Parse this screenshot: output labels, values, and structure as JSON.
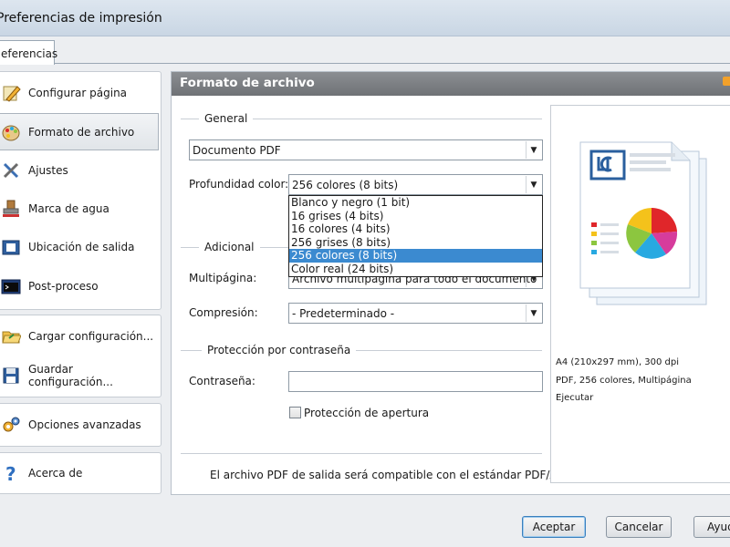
{
  "window": {
    "title": "Preferencias de impresión"
  },
  "tabs": [
    {
      "label": "eferencias"
    }
  ],
  "sidebar": {
    "items": [
      {
        "label": "Configurar página",
        "icon": "pencil-page-icon"
      },
      {
        "label": "Formato de archivo",
        "icon": "palette-icon",
        "active": true
      },
      {
        "label": "Ajustes",
        "icon": "tools-icon"
      },
      {
        "label": "Marca de agua",
        "icon": "stamp-icon"
      },
      {
        "label": "Ubicación de salida",
        "icon": "folder-output-icon"
      },
      {
        "label": "Post-proceso",
        "icon": "terminal-icon"
      },
      {
        "label": "Cargar configuración...",
        "icon": "folder-open-icon"
      },
      {
        "label": "Guardar configuración...",
        "icon": "floppy-icon"
      },
      {
        "label": "Opciones avanzadas",
        "icon": "gears-icon"
      },
      {
        "label": "Acerca de",
        "icon": "question-icon"
      }
    ]
  },
  "main": {
    "header": "Formato de archivo",
    "general": {
      "title": "General",
      "format_value": "Documento PDF",
      "color_depth_label": "Profundidad color:",
      "color_depth_value": "256 colores (8 bits)",
      "color_depth_options": [
        "Blanco y negro (1 bit)",
        "16 grises (4 bits)",
        "16 colores (4 bits)",
        "256 grises (8 bits)",
        "256 colores (8 bits)",
        "Color real (24 bits)"
      ],
      "selected_option_index": 4
    },
    "additional": {
      "title": "Adicional",
      "multipage_label": "Multipágina:",
      "multipage_value": "Archivo multipágina para todo el documento",
      "compression_label": "Compresión:",
      "compression_value": "- Predeterminado -"
    },
    "password": {
      "title": "Protección por contraseña",
      "password_label": "Contraseña:",
      "password_value": "",
      "open_protection_label": "Protección de apertura",
      "open_protection_checked": false
    },
    "footer_note": "El archivo PDF de salida será compatible con el estándar PDF/A"
  },
  "preview": {
    "line1": "A4 (210x297 mm), 300 dpi",
    "line2": "PDF, 256 colores, Multipágina",
    "line3": "Ejecutar"
  },
  "buttons": {
    "accept": "Aceptar",
    "cancel": "Cancelar",
    "help": "Ayuda"
  },
  "colors": {
    "header_bg": "#7d8084",
    "selection": "#3b8ad0",
    "chart_red": "#e0262a",
    "chart_yellow": "#f4c21b",
    "chart_green": "#8cc63f",
    "chart_blue": "#28a9e1",
    "chart_magenta": "#d63c9c"
  }
}
